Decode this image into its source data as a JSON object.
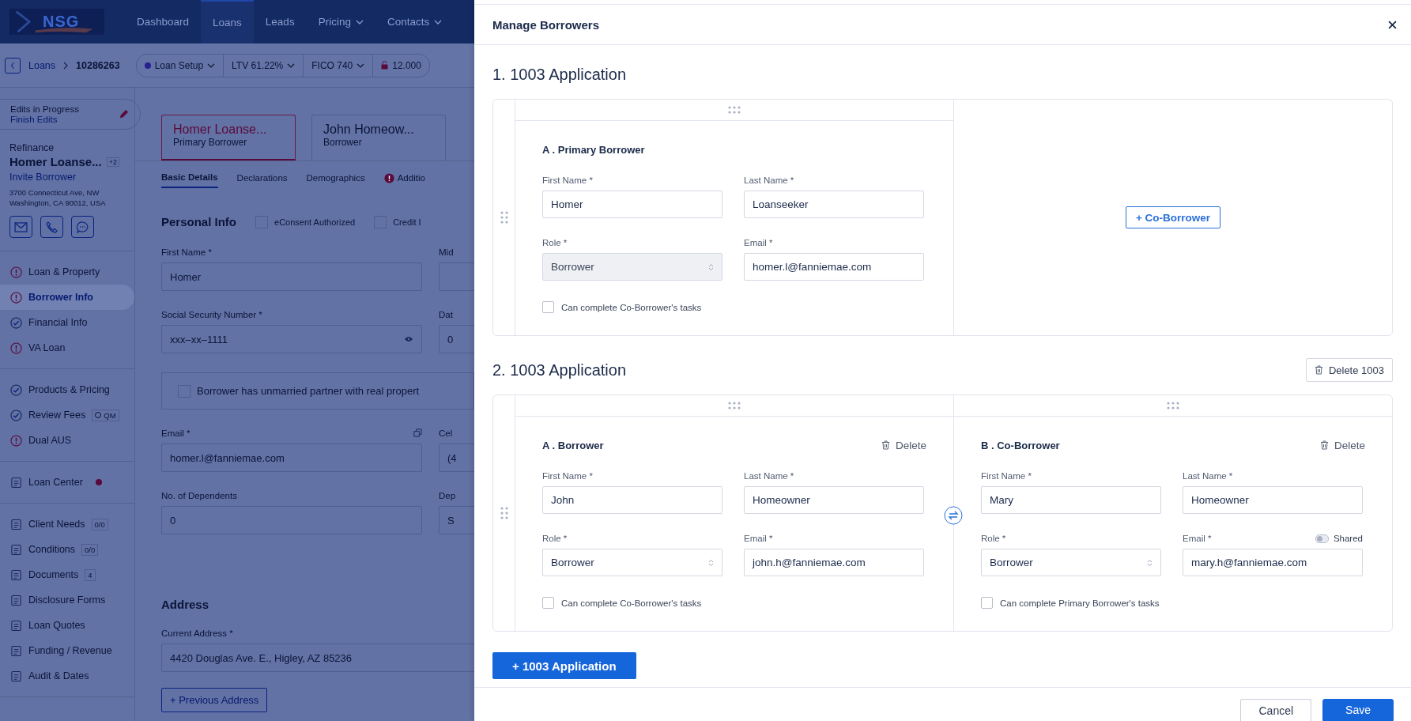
{
  "nav": {
    "logo": "NSG",
    "items": [
      {
        "label": "Dashboard",
        "selected": false,
        "menu": false
      },
      {
        "label": "Loans",
        "selected": true,
        "menu": false
      },
      {
        "label": "Leads",
        "selected": false,
        "menu": false
      },
      {
        "label": "Pricing",
        "selected": false,
        "menu": true
      },
      {
        "label": "Contacts",
        "selected": false,
        "menu": true
      }
    ]
  },
  "breadcrumb": {
    "items": [
      "Loans",
      "10286263"
    ],
    "chips": [
      {
        "label": "Loan Setup",
        "kind": "status"
      },
      {
        "label": "LTV 61.22%",
        "kind": "menu"
      },
      {
        "label": "FICO 740",
        "kind": "menu"
      },
      {
        "label": "12.000",
        "kind": "lock"
      }
    ]
  },
  "sidebar": {
    "edits": {
      "title": "Edits in Progress",
      "link": "Finish Edits"
    },
    "loan_type": "Refinance",
    "borrower": "Homer Loanse...",
    "borrower_count": "+2",
    "invite": "Invite Borrower",
    "address": [
      "3700 Connecticut Ave, NW",
      "Washington, CA 90012, USA"
    ],
    "groups": [
      [
        {
          "label": "Loan & Property",
          "kind": "step",
          "done": false,
          "selected": false
        },
        {
          "label": "Borrower Info",
          "kind": "step",
          "done": false,
          "selected": true
        },
        {
          "label": "Financial Info",
          "kind": "step",
          "done": true,
          "selected": false
        },
        {
          "label": "VA Loan",
          "kind": "step",
          "done": false,
          "selected": false
        }
      ],
      [
        {
          "label": "Products & Pricing",
          "kind": "step",
          "done": true,
          "selected": false
        },
        {
          "label": "Review Fees",
          "kind": "step",
          "done": true,
          "selected": false,
          "badge": "QM"
        },
        {
          "label": "Dual AUS",
          "kind": "step",
          "done": false,
          "selected": false
        }
      ],
      [
        {
          "label": "Loan Center",
          "kind": "tool",
          "alert": true,
          "selected": false
        }
      ],
      [
        {
          "label": "Client Needs",
          "kind": "tool",
          "alert": false,
          "selected": false,
          "badge": "0/0"
        },
        {
          "label": "Conditions",
          "kind": "tool",
          "alert": false,
          "selected": false,
          "badge": "0/0"
        },
        {
          "label": "Documents",
          "kind": "tool",
          "alert": false,
          "selected": false,
          "badge": "4"
        },
        {
          "label": "Disclosure Forms",
          "kind": "tool",
          "alert": false,
          "selected": false
        },
        {
          "label": "Loan Quotes",
          "kind": "tool",
          "alert": false,
          "selected": false
        },
        {
          "label": "Funding / Revenue",
          "kind": "tool",
          "alert": false,
          "selected": false
        },
        {
          "label": "Audit & Dates",
          "kind": "tool",
          "alert": false,
          "selected": false
        }
      ]
    ]
  },
  "main": {
    "borrower_tabs": [
      {
        "name": "Homer Loanse...",
        "role": "Primary Borrower",
        "selected": true
      },
      {
        "name": "John Homeow...",
        "role": "Borrower",
        "selected": false
      }
    ],
    "section_tabs": [
      {
        "label": "Basic Details",
        "selected": true,
        "alert": false
      },
      {
        "label": "Declarations",
        "selected": false,
        "alert": false
      },
      {
        "label": "Demographics",
        "selected": false,
        "alert": false
      },
      {
        "label": "Additio",
        "selected": false,
        "alert": true
      }
    ],
    "personal_info": {
      "title": "Personal Info",
      "checks": [
        {
          "label": "eConsent Authorized",
          "checked": false
        },
        {
          "label": "Credit I",
          "checked": false
        }
      ]
    },
    "blocks": [
      {
        "kind": "fields",
        "fields": [
          {
            "label": "First Name *",
            "value": "Homer",
            "kind": "text"
          },
          {
            "label": "Mid",
            "kind": "text"
          }
        ]
      },
      {
        "kind": "fields",
        "fields": [
          {
            "label": "Social Security Number *",
            "value": "xxx–xx–1111",
            "kind": "secret"
          },
          {
            "label": "Dat",
            "value": "0",
            "kind": "text"
          }
        ]
      },
      {
        "kind": "check",
        "label": "Borrower has unmarried partner with real propert",
        "checked": false
      },
      {
        "kind": "fields",
        "fields": [
          {
            "label": "Email *",
            "value": "homer.l@fanniemae.com",
            "kind": "copy"
          },
          {
            "label": "Cel",
            "value": "(4",
            "kind": "text"
          }
        ]
      },
      {
        "kind": "fields",
        "fields": [
          {
            "label": "No. of Dependents",
            "value": "0",
            "kind": "text"
          },
          {
            "label": "Dep",
            "value": "S",
            "kind": "text"
          }
        ]
      }
    ],
    "address": {
      "title": "Address",
      "label": "Current Address *",
      "value": "4420 Douglas Ave. E., Higley, AZ 85236",
      "button": "+ Previous Address"
    }
  },
  "modal": {
    "title": "Manage Borrowers",
    "applications": [
      {
        "title": "1. 1003 Application",
        "add_co_borrower": "+ Co-Borrower",
        "borrowers": [
          {
            "heading": "A . Primary Borrower",
            "fields": [
              {
                "label": "First Name *",
                "value": "Homer",
                "kind": "text"
              },
              {
                "label": "Last Name *",
                "value": "Loanseeker",
                "kind": "text"
              },
              {
                "label": "Role *",
                "value": "Borrower",
                "kind": "select",
                "disabled": true
              },
              {
                "label": "Email *",
                "value": "homer.l@fanniemae.com",
                "kind": "text"
              }
            ],
            "check": {
              "label": "Can complete Co-Borrower's tasks",
              "checked": false
            }
          }
        ]
      },
      {
        "title": "2. 1003 Application",
        "delete_button": "Delete 1003",
        "borrowers": [
          {
            "heading": "A . Borrower",
            "delete": "Delete",
            "fields": [
              {
                "label": "First Name *",
                "value": "John",
                "kind": "text"
              },
              {
                "label": "Last Name *",
                "value": "Homeowner",
                "kind": "text"
              },
              {
                "label": "Role *",
                "value": "Borrower",
                "kind": "select",
                "disabled": false
              },
              {
                "label": "Email *",
                "value": "john.h@fanniemae.com",
                "kind": "text"
              }
            ],
            "check": {
              "label": "Can complete Co-Borrower's tasks",
              "checked": false
            }
          },
          {
            "heading": "B . Co-Borrower",
            "delete": "Delete",
            "fields": [
              {
                "label": "First Name *",
                "value": "Mary",
                "kind": "text"
              },
              {
                "label": "Last Name *",
                "value": "Homeowner",
                "kind": "text"
              },
              {
                "label": "Role *",
                "value": "Borrower",
                "kind": "select",
                "disabled": false
              },
              {
                "label": "Email *",
                "value": "mary.h@fanniemae.com",
                "kind": "text",
                "toggle": {
                  "label": "Shared",
                  "on": false
                }
              }
            ],
            "check": {
              "label": "Can complete Primary Borrower's tasks",
              "checked": false
            }
          }
        ]
      }
    ],
    "add_application": "+ 1003 Application",
    "buttons": [
      {
        "label": "Cancel",
        "kind": "secondary"
      },
      {
        "label": "Save",
        "kind": "primary"
      }
    ]
  }
}
